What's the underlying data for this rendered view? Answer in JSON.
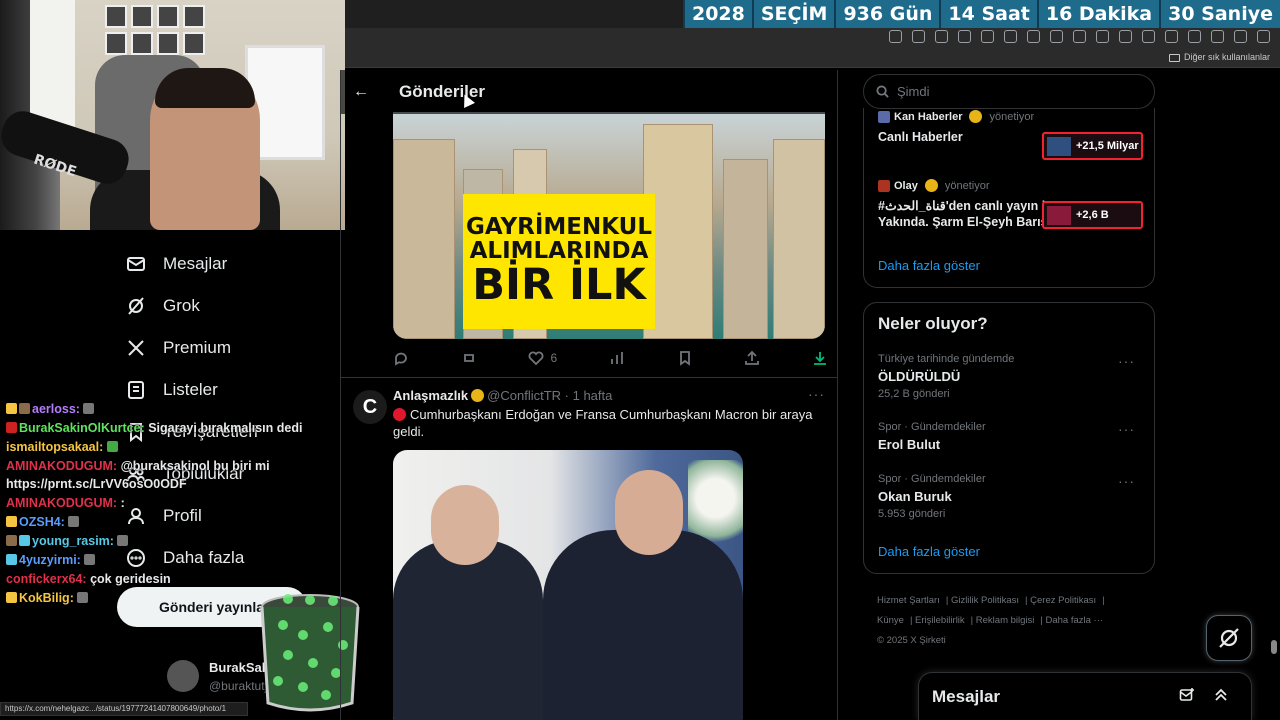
{
  "countdown": [
    "2028",
    "SEÇİM",
    "936 Gün",
    "14 Saat",
    "16 Dakika",
    "30 Saniye"
  ],
  "browser": {
    "bookmarks_other": "Diğer sık kullanılanlar",
    "status_url": "https://x.com/nehelgazc.../status/19777241407800649/photo/1"
  },
  "webcam": {
    "mic_brand": "RØDE"
  },
  "nav": {
    "items": [
      {
        "label": "Mesajlar",
        "icon": "mail-icon"
      },
      {
        "label": "Grok",
        "icon": "grok-icon"
      },
      {
        "label": "Premium",
        "icon": "x-logo-icon"
      },
      {
        "label": "Listeler",
        "icon": "list-icon"
      },
      {
        "label": "Yer İşaretleri",
        "icon": "bookmark-icon"
      },
      {
        "label": "Topluluklar",
        "icon": "communities-icon"
      },
      {
        "label": "Profil",
        "icon": "profile-icon"
      },
      {
        "label": "Daha fazla",
        "icon": "more-circle-icon"
      }
    ],
    "post_button": "Gönderi yayınla",
    "profile_name": "BurakSakinOl",
    "profile_handle": "@buraktut_"
  },
  "chat": [
    {
      "user": "aerloss:",
      "msg": "",
      "color": "#b57cff"
    },
    {
      "user": "BurakSakinOlKurtce:",
      "msg": "Sigarayı bırakmalısın dedi",
      "color": "#5ee35e"
    },
    {
      "user": "ismailtopsakaal:",
      "msg": "",
      "color": "#f5c542"
    },
    {
      "user": "AMINAKODUGUM:",
      "msg": "@buraksakinol bu biri mi https://prnt.sc/LrVV6osO0ODF",
      "color": "#e0314a"
    },
    {
      "user": "AMINAKODUGUM:",
      "msg": ":",
      "color": "#e0314a"
    },
    {
      "user": "OZSH4:",
      "msg": "",
      "color": "#5b9cff"
    },
    {
      "user": "young_rasim:",
      "msg": "",
      "color": "#57c8e6"
    },
    {
      "user": "4yuzyirmi:",
      "msg": "",
      "color": "#5b9cff"
    },
    {
      "user": "confickerx64:",
      "msg": "çok geridesin",
      "color": "#e0314a"
    },
    {
      "user": "KokBilig:",
      "msg": "",
      "color": "#f5c542"
    }
  ],
  "main": {
    "title": "Gönderiler",
    "tweet1": {
      "banner": [
        "GAYRİMENKUL",
        "ALIMLARINDA",
        "BİR İLK"
      ],
      "likes": "6"
    },
    "tweet2": {
      "name": "Anlaşmazlık",
      "handle": "@ConflictTR",
      "time": "· 1 hafta",
      "text": "Cumhurbaşkanı Erdoğan ve Fransa Cumhurbaşkanı Macron bir araya geldi."
    }
  },
  "sidebar": {
    "search_placeholder": "Şimdi",
    "live": [
      {
        "source": "Kan Haberler",
        "suffix": "yönetiyor",
        "title": "Canlı Haberler",
        "count": "+21,5 Milyar"
      },
      {
        "source": "Olay",
        "suffix": "yönetiyor",
        "title": "#قناة_الحدث'den canlı yayın | Yakında. Şarm El-Şeyh Barış...",
        "count": "+2,6 B"
      }
    ],
    "show_more": "Daha fazla göster",
    "trends_title": "Neler oluyor?",
    "trends": [
      {
        "context": "Türkiye tarihinde gündemde",
        "name": "ÖLDÜRÜLDÜ",
        "count": "25,2 B gönderi"
      },
      {
        "context": "Spor · Gündemdekiler",
        "name": "Erol Bulut",
        "count": ""
      },
      {
        "context": "Spor · Gündemdekiler",
        "name": "Okan Buruk",
        "count": "5.953 gönderi"
      }
    ],
    "footer": [
      "Hizmet Şartları",
      "Gizlilik Politikası",
      "Çerez Politikası",
      "Künye",
      "Erişilebilirlik",
      "Reklam bilgisi",
      "Daha fazla ···",
      "© 2025 X Şirketi"
    ],
    "messages_drawer": "Mesajlar"
  }
}
